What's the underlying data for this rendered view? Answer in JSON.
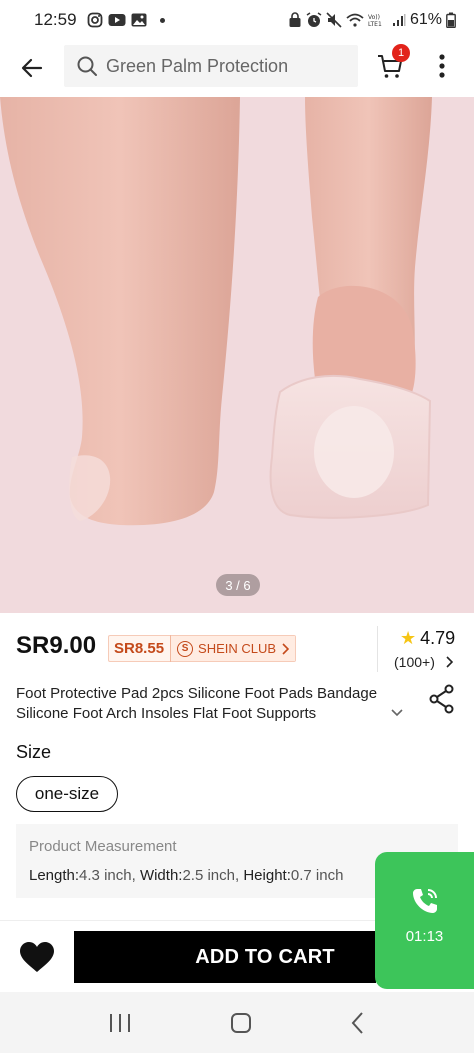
{
  "status_bar": {
    "time": "12:59",
    "battery": "61%"
  },
  "header": {
    "search_placeholder": "Green Palm Protection",
    "cart_count": "1"
  },
  "gallery": {
    "indicator": "3 / 6"
  },
  "pricing": {
    "price": "SR9.00",
    "club_price": "SR8.55",
    "club_label": "SHEIN CLUB",
    "rating": "4.79",
    "reviews": "(100+)"
  },
  "product": {
    "title": "Foot Protective Pad 2pcs Silicone Foot Pads Bandage Silicone Foot Arch Insoles Flat Foot Supports"
  },
  "size": {
    "label": "Size",
    "options": [
      "one-size"
    ]
  },
  "measurement": {
    "title": "Product Measurement",
    "length_label": "Length:",
    "length_value": "4.3 inch,",
    "width_label": "Width:",
    "width_value": "2.5 inch,",
    "height_label": "Height:",
    "height_value": "0.7 inch"
  },
  "call": {
    "duration": "01:13"
  },
  "actions": {
    "add_to_cart": "ADD TO CART"
  },
  "colors": {
    "accent_club": "#c44a1b",
    "call_green": "#3dc55a",
    "badge_red": "#e2231a",
    "image_bg": "#f1dadd"
  }
}
